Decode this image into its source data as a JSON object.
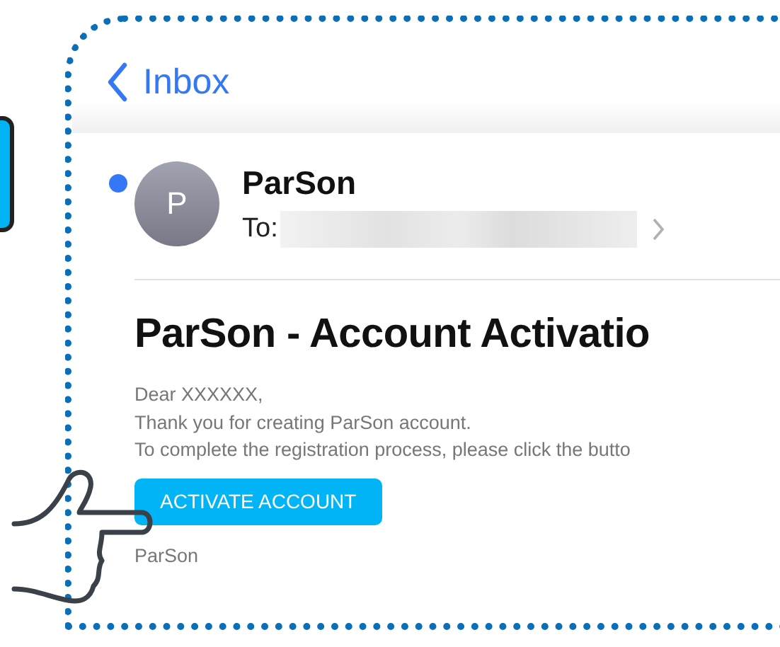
{
  "nav": {
    "back_label": "Inbox"
  },
  "message": {
    "unread": true,
    "avatar_letter": "P",
    "sender": "ParSon",
    "to_label": "To:",
    "subject": "ParSon - Account Activatio",
    "body_lines": [
      "Dear XXXXXX,",
      "Thank you for creating ParSon account.",
      "To complete the registration process, please click the butto"
    ],
    "button": "ACTIVATE ACCOUNT",
    "signature": "ParSon"
  }
}
